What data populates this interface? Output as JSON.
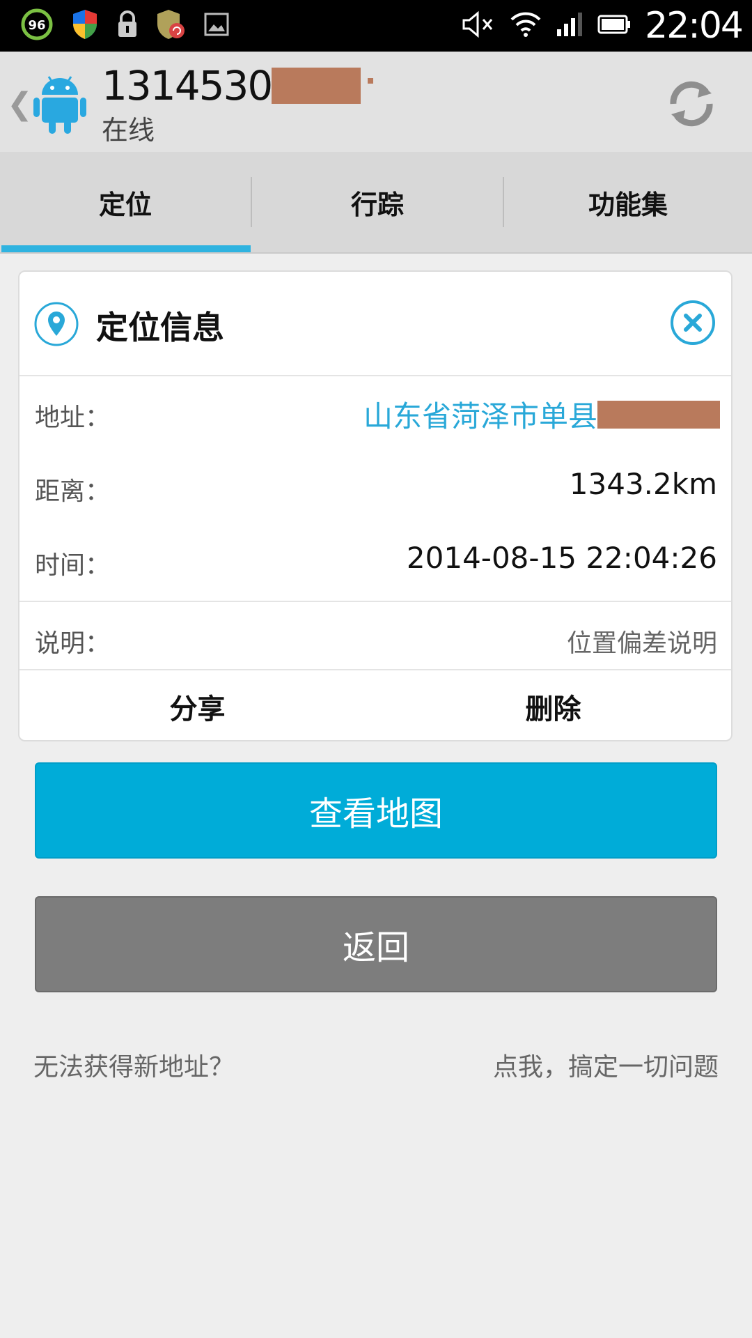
{
  "status_bar": {
    "battery_badge": "96",
    "time": "22:04"
  },
  "header": {
    "phone_number_visible": "1314530",
    "status": "在线"
  },
  "tabs": [
    {
      "label": "定位",
      "active": true
    },
    {
      "label": "行踪",
      "active": false
    },
    {
      "label": "功能集",
      "active": false
    }
  ],
  "card": {
    "title": "定位信息",
    "rows": {
      "address": {
        "label": "地址：",
        "value": "山东省菏泽市单县"
      },
      "distance": {
        "label": "距离：",
        "value": "1343.2km"
      },
      "time": {
        "label": "时间：",
        "value": "2014-08-15 22:04:26"
      },
      "note": {
        "label": "说明：",
        "value": "位置偏差说明"
      }
    },
    "actions": {
      "share": "分享",
      "delete": "删除"
    }
  },
  "buttons": {
    "view_map": "查看地图",
    "back": "返回"
  },
  "footer": {
    "question": "无法获得新地址？",
    "help_link": "点我，搞定一切问题"
  },
  "colors": {
    "accent": "#00acd8",
    "tab_indicator": "#2fb3e0",
    "back_button": "#7d7d7d",
    "redaction": "#b97a5c"
  }
}
